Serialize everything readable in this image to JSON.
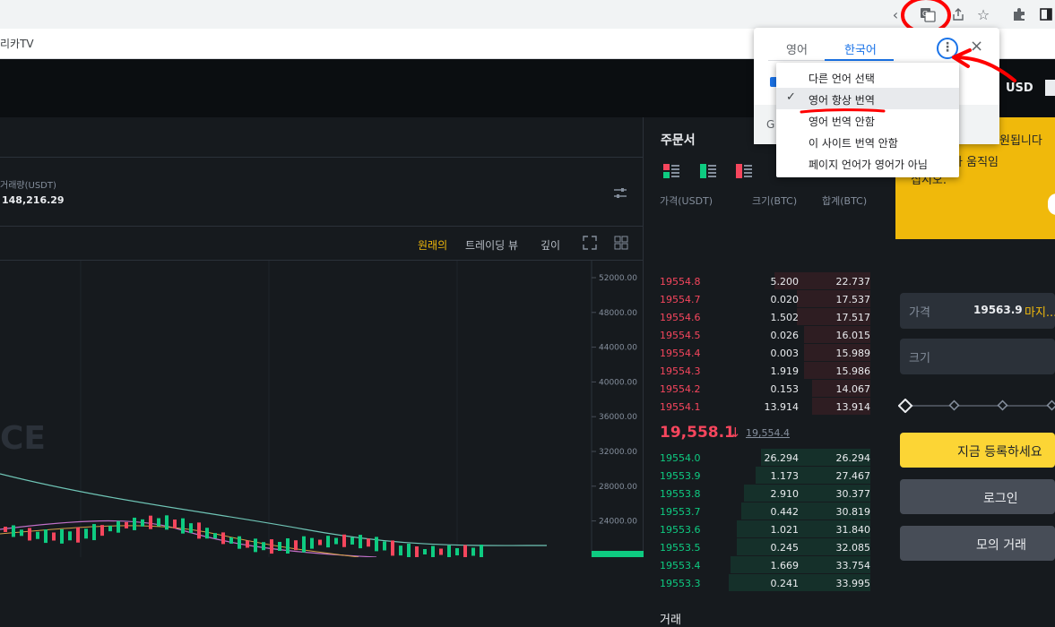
{
  "browser": {
    "bookmark_label": "리카TV",
    "icons": [
      "back-chevron-icon",
      "translate-icon",
      "share-icon",
      "star-icon",
      "extensions-icon",
      "sidebar-icon"
    ]
  },
  "header": {
    "currency": "USD"
  },
  "chart_panel": {
    "volume_label": "거래량(USDT)",
    "volume_value": "148,216.29",
    "tabs": [
      "원래의",
      "트레이딩 뷰",
      "깊이"
    ],
    "watermark": "CE",
    "y_ticks": [
      "52000.00",
      "48000.00",
      "44000.00",
      "40000.00",
      "36000.00",
      "32000.00",
      "28000.00",
      "24000.00"
    ]
  },
  "order_book": {
    "title": "주문서",
    "columns": [
      "가격(USDT)",
      "크기(BTC)",
      "합계(BTC)"
    ],
    "asks": [
      {
        "price": "19554.8",
        "size": "5.200",
        "total": "22.737",
        "fill": 0.68
      },
      {
        "price": "19554.7",
        "size": "0.020",
        "total": "17.537",
        "fill": 0.52
      },
      {
        "price": "19554.6",
        "size": "1.502",
        "total": "17.517",
        "fill": 0.52
      },
      {
        "price": "19554.5",
        "size": "0.026",
        "total": "16.015",
        "fill": 0.47
      },
      {
        "price": "19554.4",
        "size": "0.003",
        "total": "15.989",
        "fill": 0.47
      },
      {
        "price": "19554.3",
        "size": "1.919",
        "total": "15.986",
        "fill": 0.47
      },
      {
        "price": "19554.2",
        "size": "0.153",
        "total": "14.067",
        "fill": 0.41
      },
      {
        "price": "19554.1",
        "size": "13.914",
        "total": "13.914",
        "fill": 0.41
      }
    ],
    "last_price": "19,558.1",
    "last_arrow": "↓",
    "mark_price": "19,554.4",
    "bids": [
      {
        "price": "19554.0",
        "size": "26.294",
        "total": "26.294",
        "fill": 0.77
      },
      {
        "price": "19553.9",
        "size": "1.173",
        "total": "27.467",
        "fill": 0.81
      },
      {
        "price": "19553.8",
        "size": "2.910",
        "total": "30.377",
        "fill": 0.89
      },
      {
        "price": "19553.7",
        "size": "0.442",
        "total": "30.819",
        "fill": 0.91
      },
      {
        "price": "19553.6",
        "size": "1.021",
        "total": "31.840",
        "fill": 0.94
      },
      {
        "price": "19553.5",
        "size": "0.245",
        "total": "32.085",
        "fill": 0.94
      },
      {
        "price": "19553.4",
        "size": "1.669",
        "total": "33.754",
        "fill": 0.99
      },
      {
        "price": "19553.3",
        "size": "0.241",
        "total": "33.995",
        "fill": 1.0
      }
    ],
    "trades_title": "거래"
  },
  "trade_panel": {
    "banner_line1": "원됩니다",
    "banner_line2": "고 성과와 움직임",
    "banner_line3": "십시오.",
    "price_label": "가격",
    "price_value": "19563.9",
    "price_type": "마지...",
    "size_label": "크기",
    "register_button": "지금 등록하세요",
    "login_button": "로그인",
    "demo_button": "모의 거래"
  },
  "translate_popup": {
    "tab_source": "영어",
    "tab_target": "한국어",
    "partial_g": "G",
    "menu": [
      "다른 언어 선택",
      "영어 항상 번역",
      "영어 번역 안함",
      "이 사이트 번역 안함",
      "페이지 언어가 영어가 아님"
    ],
    "checked_index": 1
  },
  "colors": {
    "ask": "#f6465d",
    "bid": "#0ecb81",
    "accent_yellow": "#fcd535",
    "annotation_red": "#ff0000",
    "chrome_blue": "#1a73e8"
  }
}
